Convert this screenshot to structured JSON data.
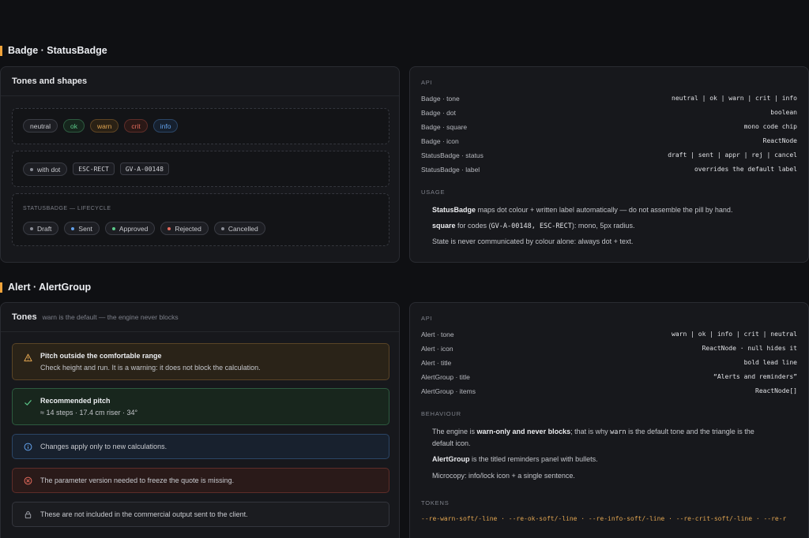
{
  "section1": {
    "title": "Badge · StatusBadge"
  },
  "section2": {
    "title": "Alert · AlertGroup"
  },
  "tones_card": {
    "title": "Tones and shapes",
    "tone_pills": [
      {
        "label": "neutral",
        "color": "#c8c9ce"
      },
      {
        "label": "ok",
        "color": "#5cc98a"
      },
      {
        "label": "warn",
        "color": "#e0a450"
      },
      {
        "label": "crit",
        "color": "#e46a5c"
      },
      {
        "label": "info",
        "color": "#62a0ea"
      }
    ],
    "with_dot": "with dot",
    "code_chips": [
      "ESC-RECT",
      "GV-A-00148"
    ],
    "lifecycle_caption": "STATUSBADGE — LIFECYCLE",
    "lifecycle": [
      {
        "label": "Draft",
        "color": "#8a8d96"
      },
      {
        "label": "Sent",
        "color": "#62a0ea"
      },
      {
        "label": "Approved",
        "color": "#5cc98a"
      },
      {
        "label": "Rejected",
        "color": "#e46a5c"
      },
      {
        "label": "Cancelled",
        "color": "#8a8d96"
      }
    ]
  },
  "badge_api": {
    "api_label": "API",
    "rows": [
      {
        "k": "Badge · tone",
        "v": "neutral | ok | warn | crit | info"
      },
      {
        "k": "Badge · dot",
        "v": "boolean"
      },
      {
        "k": "Badge · square",
        "v": "mono code chip"
      },
      {
        "k": "Badge · icon",
        "v": "ReactNode"
      },
      {
        "k": "StatusBadge · status",
        "v": "draft | sent | appr | rej | cancel"
      },
      {
        "k": "StatusBadge · label",
        "v": "overrides the default label"
      }
    ],
    "usage_label": "USAGE",
    "usage1_b": "StatusBadge",
    "usage1_rest": " maps dot colour + written label automatically — do not assemble the pill by hand.",
    "usage2_b": "square",
    "usage2_a": " for codes (",
    "usage2_code": "GV-A-00148, ESC-RECT",
    "usage2_rest": "): mono, 5px radius.",
    "usage3": "State is never communicated by colour alone: always dot + text."
  },
  "alerts_card": {
    "title": "Tones",
    "subtitle": "warn is the default — the engine never blocks",
    "warn_title": "Pitch outside the comfortable range",
    "warn_body": "Check height and run. It is a warning: it does not block the calculation.",
    "ok_title": "Recommended pitch",
    "ok_body": "≈ 14 steps · 17.4 cm riser · 34°",
    "info_text": "Changes apply only to new calculations.",
    "crit_text": "The parameter version needed to freeze the quote is missing.",
    "neutral_text": "These are not included in the commercial output sent to the client.",
    "colors": {
      "warn": "#e0a450",
      "ok": "#5cc98a",
      "info": "#62a0ea",
      "crit": "#e46a5c",
      "neutral": "#9a9ca4"
    }
  },
  "alert_api": {
    "api_label": "API",
    "rows": [
      {
        "k": "Alert · tone",
        "v": "warn | ok | info | crit | neutral"
      },
      {
        "k": "Alert · icon",
        "v": "ReactNode · null hides it"
      },
      {
        "k": "Alert · title",
        "v": "bold lead line"
      },
      {
        "k": "AlertGroup · title",
        "v": "“Alerts and reminders”"
      },
      {
        "k": "AlertGroup · items",
        "v": "ReactNode[]"
      }
    ],
    "behaviour_label": "BEHAVIOUR",
    "b1_a": "The engine is ",
    "b1_b": "warn-only and never blocks",
    "b1_c": "; that is why ",
    "b1_code": "warn",
    "b1_d": " is the default tone and the triangle is the default icon.",
    "b2_b": "AlertGroup",
    "b2_rest": " is the titled reminders panel with bullets.",
    "b3": "Microcopy: info/lock icon + a single sentence.",
    "tokens_label": "TOKENS",
    "tokens": "--re-warn-soft/-line · --re-ok-soft/-line · --re-info-soft/-line · --re-crit-soft/-line · --re-r"
  }
}
